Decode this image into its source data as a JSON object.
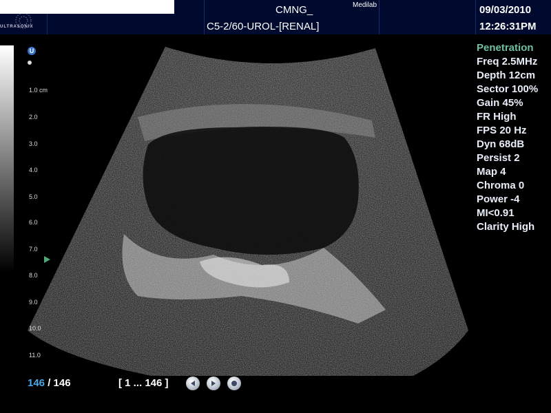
{
  "header": {
    "logo_text": "ULTRASONIX",
    "patient": "CMNG_",
    "site": "Medilab",
    "preset": "C5-2/60-UROL-[RENAL]",
    "date": "09/03/2010",
    "time": "12:26:31PM"
  },
  "probe_marker": "U",
  "depth_scale": {
    "first_label": "1.0 cm",
    "labels": [
      "2.0",
      "3.0",
      "4.0",
      "5.0",
      "6.0",
      "7.0",
      "8.0",
      "9.0",
      "10.0",
      "11.0"
    ]
  },
  "params": {
    "mode": "Penetration",
    "items": [
      "Freq 2.5MHz",
      "Depth 12cm",
      "Sector 100%",
      "Gain 45%",
      "FR High",
      "FPS 20 Hz",
      "Dyn 68dB",
      "Persist 2",
      "Map 4",
      "Chroma 0",
      "Power -4",
      "MI<0.91",
      "Clarity High"
    ]
  },
  "footer": {
    "current_frame": "146",
    "separator": " / ",
    "total_frames": "146",
    "frame_range": "[ 1 ... 146 ]"
  },
  "colors": {
    "header_bg": "#000a2e",
    "accent_mode": "#6fc0a0",
    "frame_counter": "#4aa8e8",
    "focus_marker": "#4ea87c"
  },
  "icons": {
    "back": "play-back-icon",
    "forward": "play-forward-icon",
    "stop": "stop-icon"
  }
}
